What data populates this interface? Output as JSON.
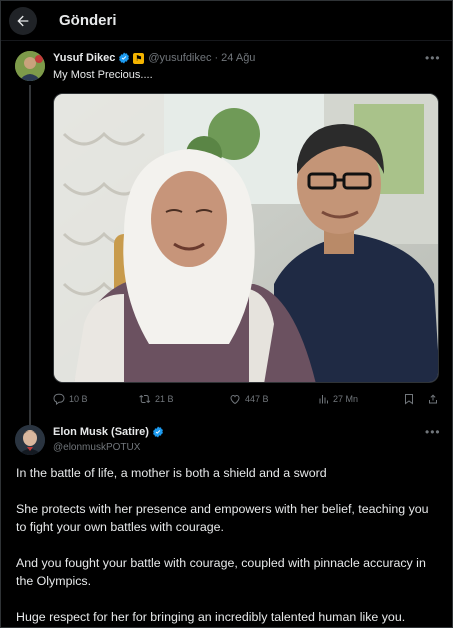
{
  "header": {
    "title": "Gönderi"
  },
  "post": {
    "author_name": "Yusuf Dikec",
    "author_handle": "@yusufdikec",
    "date": "24 Ağu",
    "text": "My Most Precious....",
    "stats": {
      "replies": "10 B",
      "reposts": "21 B",
      "likes": "447 B",
      "views": "27 Mn"
    }
  },
  "reply": {
    "author_name": "Elon Musk (Satire)",
    "author_handle": "@elonmuskPOTUX",
    "paragraphs": [
      "In the battle of life, a mother is both a shield and a sword",
      "She protects with her presence and empowers with her belief, teaching you to fight your own battles with courage.",
      "And you fought your battle with courage, coupled with pinnacle accuracy in the Olympics.",
      "Huge respect for her for bringing an incredibly talented human like you."
    ]
  },
  "colors": {
    "background": "#000000",
    "text": "#e7e9ea",
    "muted": "#71767b",
    "verified": "#1d9bf0",
    "border": "#2f3336"
  },
  "icons": [
    "back-arrow-icon",
    "verified-icon",
    "flag-badge-icon",
    "more-icon",
    "reply-icon",
    "repost-icon",
    "like-icon",
    "views-icon",
    "bookmark-icon",
    "share-icon"
  ]
}
